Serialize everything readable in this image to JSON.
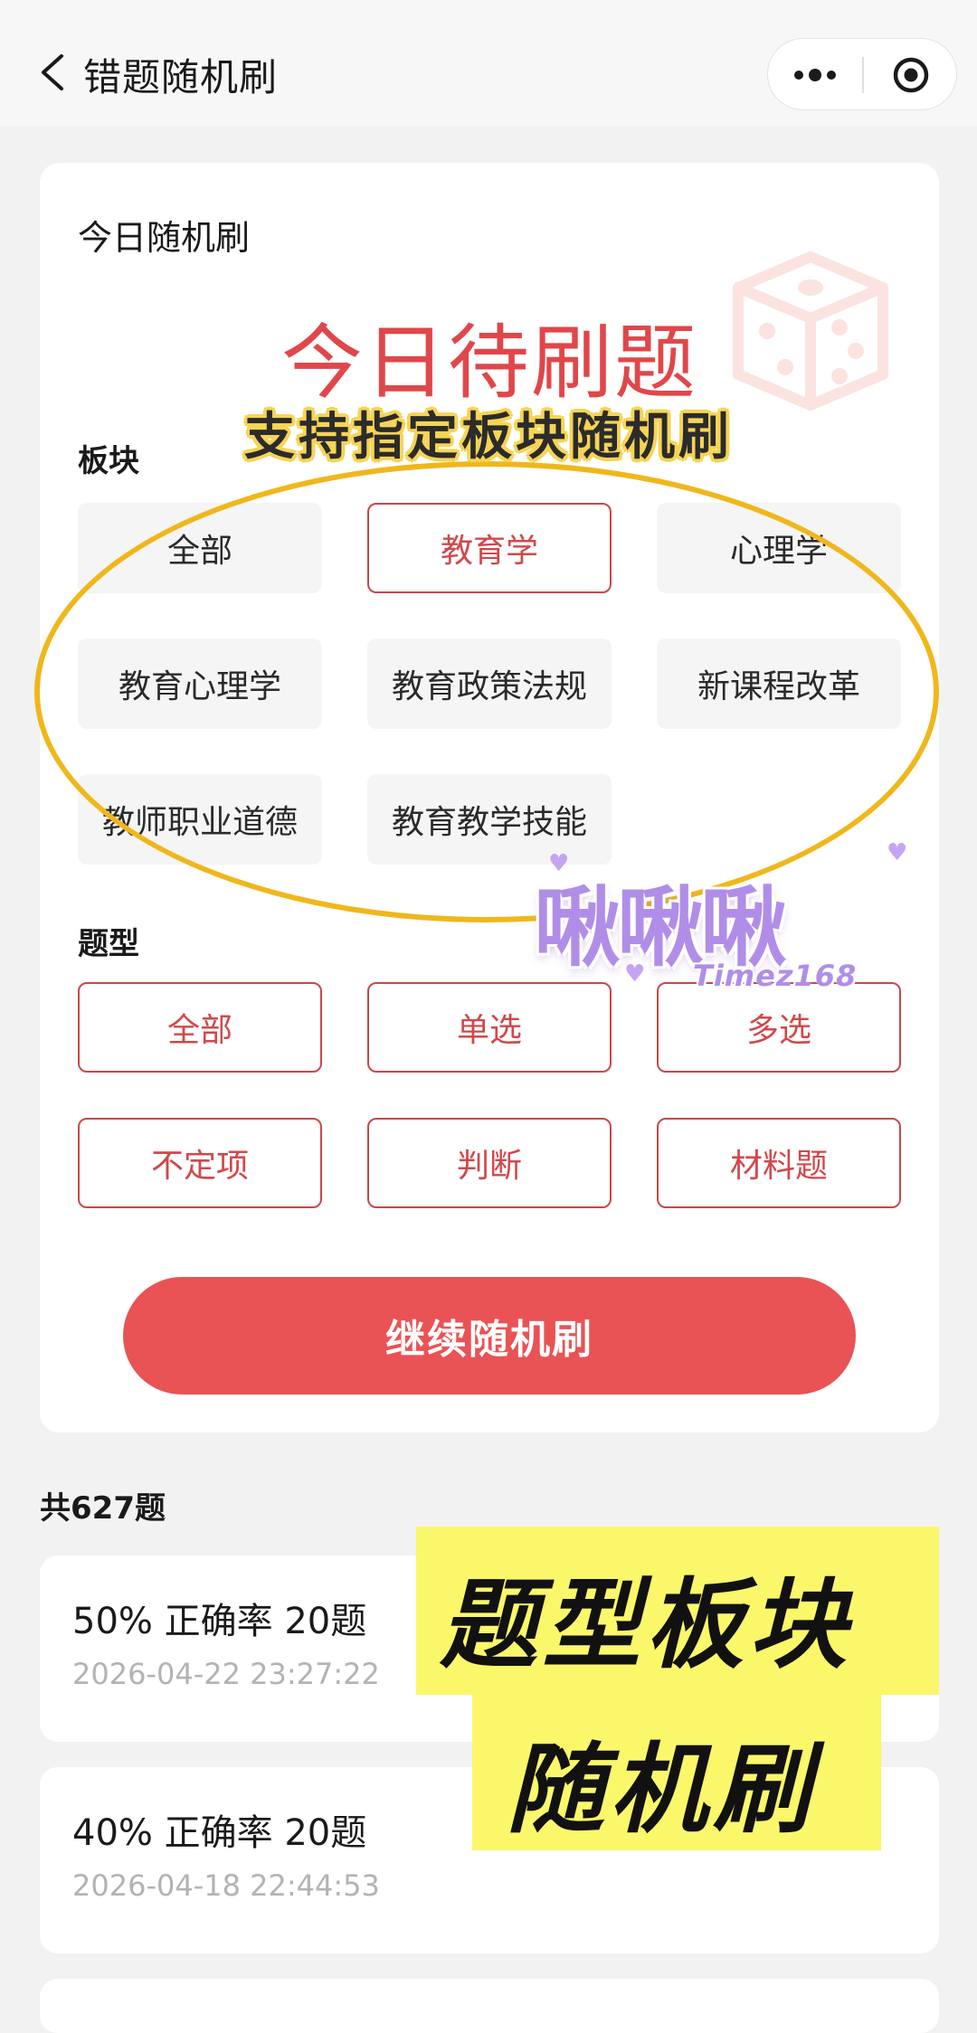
{
  "nav": {
    "title": "错题随机刷",
    "back_icon": "chevron-left-icon",
    "more_icon": "more-dots-icon",
    "close_icon": "target-icon"
  },
  "card": {
    "title": "今日随机刷",
    "hero": "今日待刷题",
    "dice_icon": "dice-icon",
    "section_label": "板块",
    "sections": [
      "全部",
      "教育学",
      "心理学",
      "教育心理学",
      "教育政策法规",
      "新课程改革",
      "教师职业道德",
      "教育教学技能"
    ],
    "selected_section": "教育学",
    "type_label": "题型",
    "types": [
      "全部",
      "单选",
      "多选",
      "不定项",
      "判断",
      "材料题"
    ],
    "continue_label": "继续随机刷"
  },
  "overlay": {
    "support_text": "支持指定板块随机刷",
    "watermark": "啾啾啾",
    "watermark_sub": "Timez168",
    "banner_line1": "题型板块",
    "banner_line2": "随机刷",
    "ellipse_color": "#f0b71c",
    "banner_color": "#faf76a"
  },
  "summary": {
    "total": "共627题"
  },
  "records": [
    {
      "main": "50% 正确率 20题",
      "time": "2026-04-22 23:27:22"
    },
    {
      "main": "40% 正确率 20题",
      "time": "2026-04-18 22:44:53"
    }
  ],
  "colors": {
    "accent": "#e95355",
    "chip_border": "#c9474a",
    "hero": "#e0474a"
  }
}
